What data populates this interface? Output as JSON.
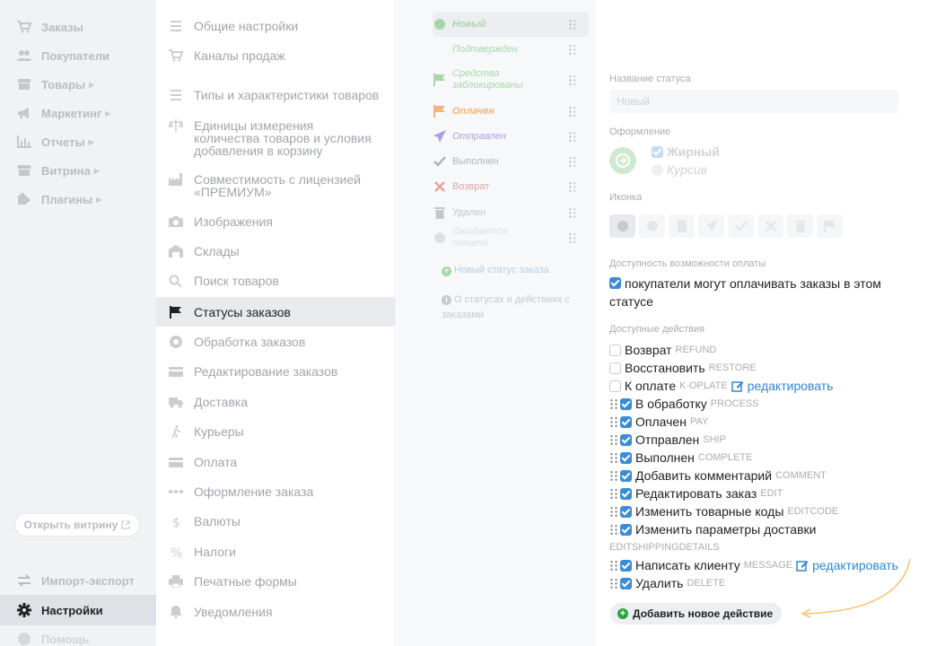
{
  "nav": {
    "items": [
      {
        "label": "Заказы",
        "icon": "cart-icon",
        "arrow": false
      },
      {
        "label": "Покупатели",
        "icon": "users-icon",
        "arrow": false
      },
      {
        "label": "Товары",
        "icon": "box-icon",
        "arrow": true
      },
      {
        "label": "Маркетинг",
        "icon": "megaphone-icon",
        "arrow": true
      },
      {
        "label": "Отчеты",
        "icon": "chart-icon",
        "arrow": true
      },
      {
        "label": "Витрина",
        "icon": "storefront-icon",
        "arrow": true
      },
      {
        "label": "Плагины",
        "icon": "puzzle-icon",
        "arrow": true
      }
    ],
    "open_store": "Открыть витрину",
    "import_export": "Импорт-экспорт",
    "settings": "Настройки",
    "help": "Помощь"
  },
  "settings_menu": [
    {
      "label": "Общие настройки",
      "icon": "list-icon"
    },
    {
      "label": "Каналы продаж",
      "icon": "cart-icon"
    },
    {
      "label": "Типы и характеристики товаров",
      "icon": "list-icon"
    },
    {
      "label": "Единицы измерения количества товаров и условия добавления в корзину",
      "icon": "scale-icon"
    },
    {
      "label": "Совместимость с лицензией «ПРЕМИУМ»",
      "icon": "factory-icon"
    },
    {
      "label": "Изображения",
      "icon": "camera-icon"
    },
    {
      "label": "Склады",
      "icon": "warehouse-icon"
    },
    {
      "label": "Поиск товаров",
      "icon": "search-icon"
    },
    {
      "label": "Статусы заказов",
      "icon": "flag-icon",
      "active": true
    },
    {
      "label": "Обработка заказов",
      "icon": "gear-circle-icon"
    },
    {
      "label": "Редактирование заказов",
      "icon": "card-icon"
    },
    {
      "label": "Доставка",
      "icon": "truck-icon"
    },
    {
      "label": "Курьеры",
      "icon": "walker-icon"
    },
    {
      "label": "Оплата",
      "icon": "card-icon"
    },
    {
      "label": "Оформление заказа",
      "icon": "steps-icon"
    },
    {
      "label": "Валюты",
      "icon": "dollar-icon"
    },
    {
      "label": "Налоги",
      "icon": "percent-icon"
    },
    {
      "label": "Печатные формы",
      "icon": "printer-icon"
    },
    {
      "label": "Уведомления",
      "icon": "bell-icon"
    }
  ],
  "statuses": [
    {
      "label": "Новый",
      "color": "#a9d6a9",
      "icon": "dot-icon",
      "bold": true
    },
    {
      "label": "Подтвержден",
      "color": "#a9d6a9",
      "icon": "none"
    },
    {
      "label": "Средства заблокированы",
      "color": "#a9d6a9",
      "icon": "flag-icon"
    },
    {
      "label": "Оплачен",
      "color": "#f2b47a",
      "icon": "flag-icon",
      "bold": true
    },
    {
      "label": "Отправлен",
      "color": "#b59be0",
      "icon": "plane-icon"
    },
    {
      "label": "Выполнен",
      "color": "#b0b3b8",
      "icon": "check-icon"
    },
    {
      "label": "Возврат",
      "color": "#e6a3a3",
      "icon": "cross-icon"
    },
    {
      "label": "Удален",
      "color": "#c3c6cb",
      "icon": "trash-icon"
    },
    {
      "label": "Ожидается оплата",
      "color": "#dde0e3",
      "icon": "dot-icon"
    }
  ],
  "new_status_link": "Новый статус заказа",
  "about_link": "О статусах и действиях с заказами",
  "editor": {
    "status_name_label": "Название статуса",
    "status_name_value": "Новый",
    "design_label": "Оформление",
    "bold_label": "Жирный",
    "italic_label": "Курсив",
    "icon_label": "Иконка",
    "payment_label": "Доступность возможности оплаты",
    "payment_checkbox": "покупатели могут оплачивать заказы в этом статусе",
    "actions_label": "Доступные действия",
    "edit_label": "редактировать",
    "actions": [
      {
        "label": "Возврат",
        "code": "refund",
        "checked": false,
        "draggable": false,
        "edit": false
      },
      {
        "label": "Восстановить",
        "code": "restore",
        "checked": false,
        "draggable": false,
        "edit": false
      },
      {
        "label": "К оплате",
        "code": "k-oplate",
        "checked": false,
        "draggable": false,
        "edit": true
      },
      {
        "label": "В обработку",
        "code": "process",
        "checked": true,
        "draggable": true,
        "edit": false
      },
      {
        "label": "Оплачен",
        "code": "pay",
        "checked": true,
        "draggable": true,
        "edit": false
      },
      {
        "label": "Отправлен",
        "code": "ship",
        "checked": true,
        "draggable": true,
        "edit": false
      },
      {
        "label": "Выполнен",
        "code": "complete",
        "checked": true,
        "draggable": true,
        "edit": false
      },
      {
        "label": "Добавить комментарий",
        "code": "comment",
        "checked": true,
        "draggable": true,
        "edit": false
      },
      {
        "label": "Редактировать заказ",
        "code": "edit",
        "checked": true,
        "draggable": true,
        "edit": false
      },
      {
        "label": "Изменить товарные коды",
        "code": "editcode",
        "checked": true,
        "draggable": true,
        "edit": false
      },
      {
        "label": "Изменить параметры доставки",
        "code": "editshippingdetails",
        "checked": true,
        "draggable": true,
        "edit": false
      },
      {
        "label": "Написать клиенту",
        "code": "message",
        "checked": true,
        "draggable": true,
        "edit": true
      },
      {
        "label": "Удалить",
        "code": "delete",
        "checked": true,
        "draggable": true,
        "edit": false
      }
    ],
    "add_action": "Добавить новое действие"
  },
  "colors": {
    "accent": "#3a8bd8",
    "link": "#2f86d6",
    "annotation_arrow": "#f2c46d",
    "add_green": "#2ca53b"
  }
}
